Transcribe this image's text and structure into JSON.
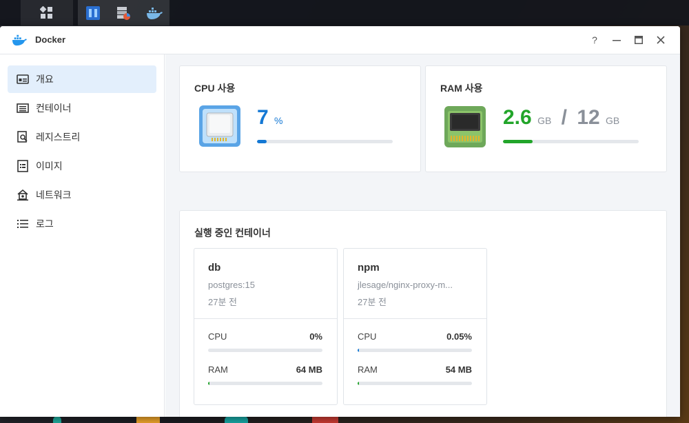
{
  "window": {
    "title": "Docker",
    "help_label": "?",
    "minimize_label": "—",
    "close_label": "✕"
  },
  "sidebar": {
    "items": [
      {
        "label": "개요",
        "icon": "overview-icon"
      },
      {
        "label": "컨테이너",
        "icon": "container-icon"
      },
      {
        "label": "레지스트리",
        "icon": "registry-icon"
      },
      {
        "label": "이미지",
        "icon": "image-icon"
      },
      {
        "label": "네트워크",
        "icon": "network-icon"
      },
      {
        "label": "로그",
        "icon": "log-icon"
      }
    ]
  },
  "cpu": {
    "title": "CPU 사용",
    "value": "7",
    "unit": "%",
    "percent": 7,
    "color": "#1478d4"
  },
  "ram": {
    "title": "RAM 사용",
    "used": "2.6",
    "used_unit": "GB",
    "separator": "/",
    "total": "12",
    "total_unit": "GB",
    "percent": 21.7,
    "color": "#22a52a"
  },
  "running": {
    "title": "실행 중인 컨테이너",
    "containers": [
      {
        "name": "db",
        "image": "postgres:15",
        "time": "27분 전",
        "cpu_label": "CPU",
        "cpu_value": "0%",
        "cpu_percent": 0,
        "ram_label": "RAM",
        "ram_value": "64 MB",
        "ram_percent": 0.5
      },
      {
        "name": "npm",
        "image": "jlesage/nginx-proxy-m...",
        "time": "27분 전",
        "cpu_label": "CPU",
        "cpu_value": "0.05%",
        "cpu_percent": 0.05,
        "ram_label": "RAM",
        "ram_value": "54 MB",
        "ram_percent": 0.4
      }
    ]
  },
  "colors": {
    "accent": "#1478d4",
    "ram": "#22a52a",
    "active_nav": "#e3effc"
  }
}
